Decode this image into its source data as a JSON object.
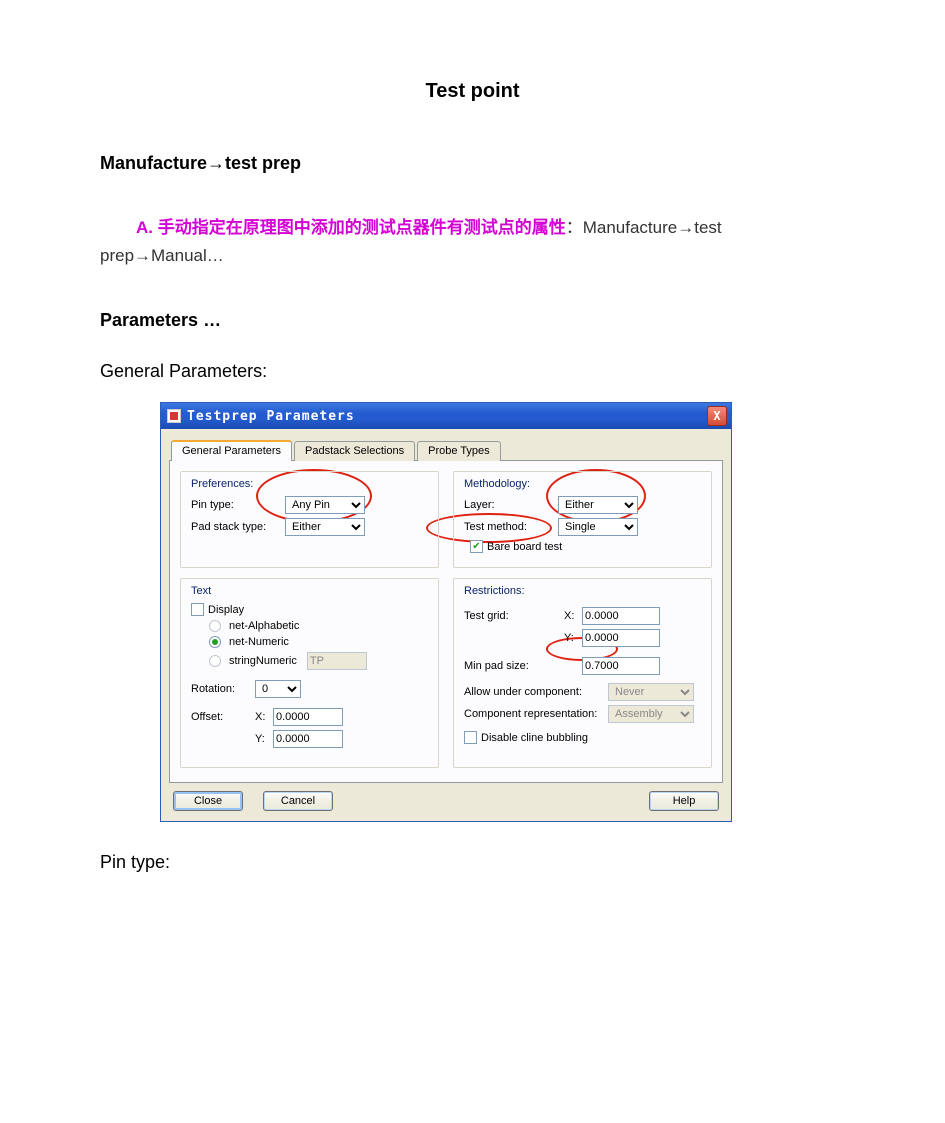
{
  "doc": {
    "title": "Test point",
    "subtitle": "Manufacture→test prep",
    "note_lead": "A. 手动指定在原理图中添加的测试点器件有测试点的属性",
    "note_tail": "：Manufacture→test prep→Manual…",
    "parameters_heading": "Parameters …",
    "general_heading": "General Parameters:",
    "bottom_label": "Pin type:"
  },
  "win": {
    "title": "Testprep Parameters",
    "close": "X",
    "tabs": {
      "general": "General Parameters",
      "padstack": "Padstack Selections",
      "probe": "Probe Types"
    },
    "prefs": {
      "title": "Preferences:",
      "pin_type_label": "Pin type:",
      "pin_type_value": "Any Pin",
      "padstack_label": "Pad stack type:",
      "padstack_value": "Either"
    },
    "method": {
      "title": "Methodology:",
      "layer_label": "Layer:",
      "layer_value": "Either",
      "testmethod_label": "Test method:",
      "testmethod_value": "Single",
      "bareboard_label": "Bare board test"
    },
    "text": {
      "title": "Text",
      "display_label": "Display",
      "opt_alpha": "net-Alphabetic",
      "opt_numeric": "net-Numeric",
      "opt_string": "stringNumeric",
      "string_value": "TP",
      "rotation_label": "Rotation:",
      "rotation_value": "0",
      "offset_label": "Offset:",
      "x_label": "X:",
      "x_value": "0.0000",
      "y_label": "Y:",
      "y_value": "0.0000"
    },
    "restr": {
      "title": "Restrictions:",
      "testgrid_label": "Test grid:",
      "x_label": "X:",
      "x_value": "0.0000",
      "y_label": "Y:",
      "y_value": "0.0000",
      "minpad_label": "Min pad size:",
      "minpad_value": "0.7000",
      "allow_label": "Allow under component:",
      "allow_value": "Never",
      "comprep_label": "Component representation:",
      "comprep_value": "Assembly",
      "disable_bubble_label": "Disable cline bubbling"
    },
    "buttons": {
      "close": "Close",
      "cancel": "Cancel",
      "help": "Help"
    }
  }
}
